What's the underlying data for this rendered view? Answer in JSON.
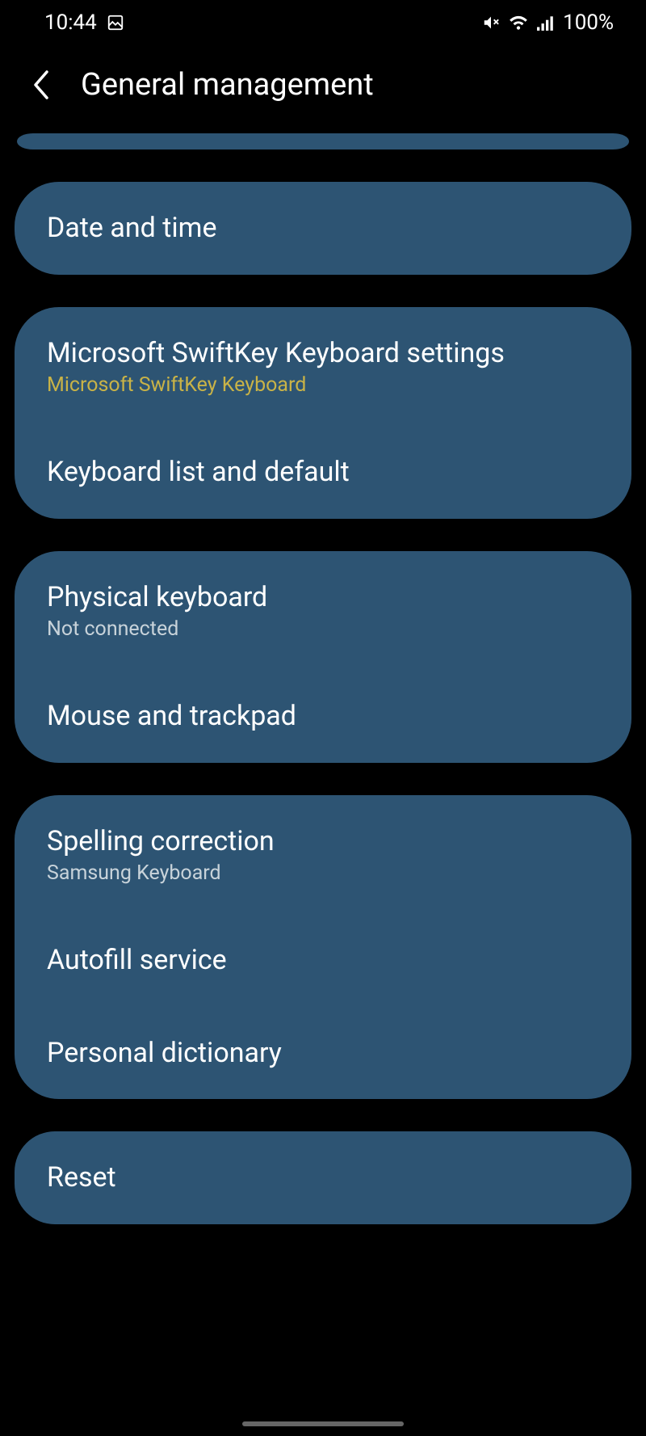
{
  "statusBar": {
    "time": "10:44",
    "battery": "100%"
  },
  "header": {
    "title": "General management"
  },
  "groups": [
    {
      "items": [
        {
          "title": "Date and time"
        }
      ]
    },
    {
      "items": [
        {
          "title": "Microsoft SwiftKey Keyboard settings",
          "subtitle": "Microsoft SwiftKey Keyboard",
          "accent": true
        },
        {
          "title": "Keyboard list and default"
        }
      ]
    },
    {
      "items": [
        {
          "title": "Physical keyboard",
          "subtitle": "Not connected"
        },
        {
          "title": "Mouse and trackpad"
        }
      ]
    },
    {
      "items": [
        {
          "title": "Spelling correction",
          "subtitle": "Samsung Keyboard"
        },
        {
          "title": "Autofill service"
        },
        {
          "title": "Personal dictionary"
        }
      ]
    },
    {
      "items": [
        {
          "title": "Reset"
        }
      ]
    }
  ]
}
